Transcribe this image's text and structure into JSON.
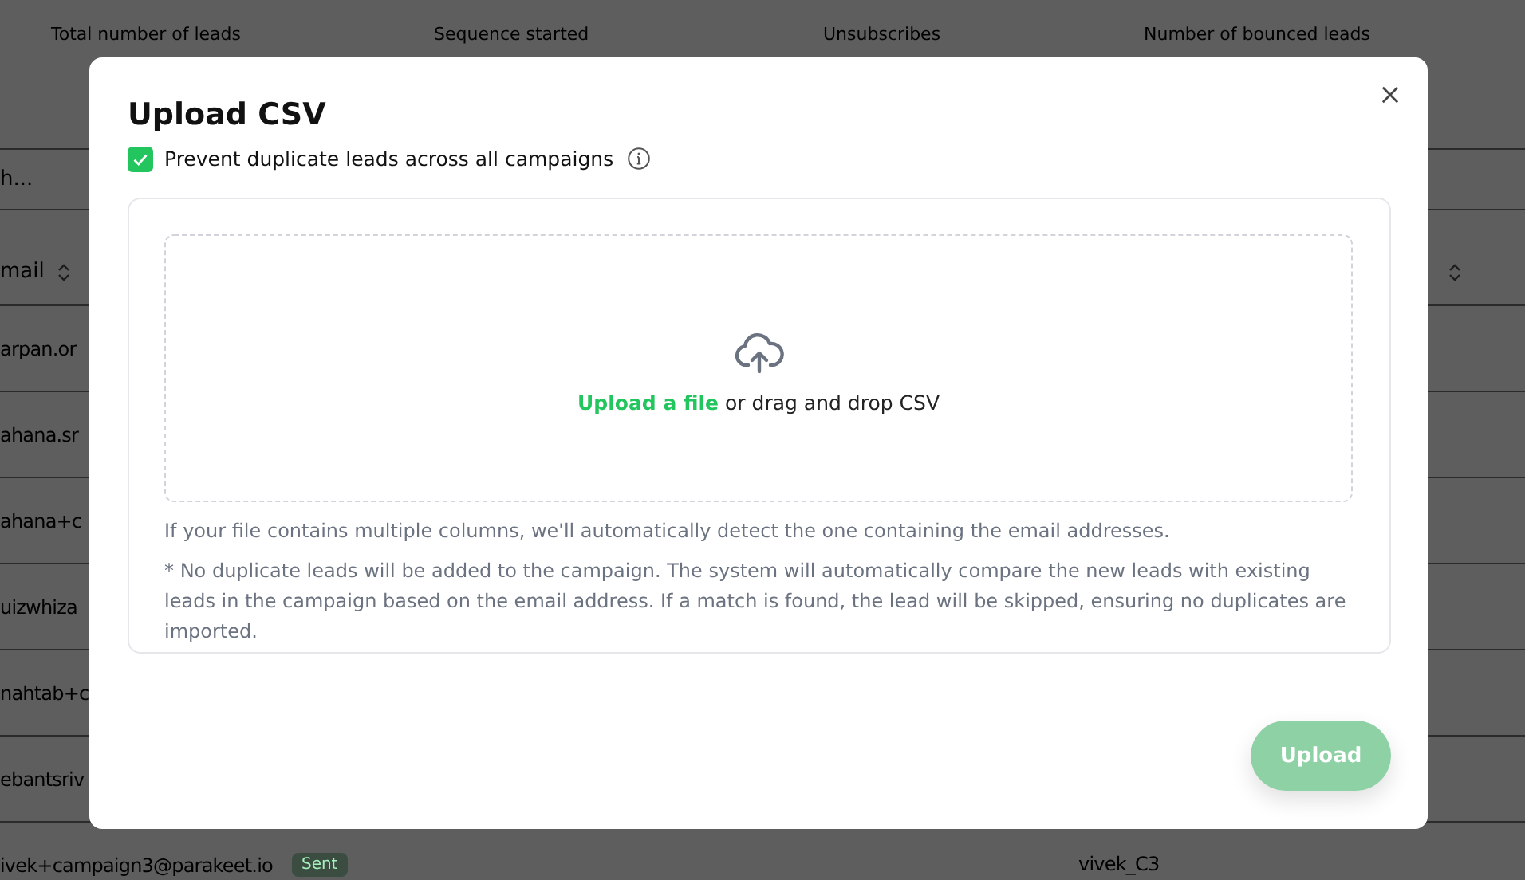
{
  "background": {
    "stats": [
      "Total number of leads",
      "Sequence started",
      "Unsubscribes",
      "Number of bounced leads"
    ],
    "search": {
      "placeholder": "h..."
    },
    "table": {
      "columns": [
        "mail"
      ],
      "rows": [
        {
          "email": "arpan.or"
        },
        {
          "email": "ahana.sr"
        },
        {
          "email": "ahana+c"
        },
        {
          "email": "uizwhiza"
        },
        {
          "email": "nahtab+c"
        },
        {
          "email": "ebantsriv"
        },
        {
          "email": "ivek+campaign3@parakeet.io",
          "status": "Sent",
          "column_3": "vivek_C3"
        }
      ]
    }
  },
  "modal": {
    "title": "Upload CSV",
    "checkbox": {
      "label": "Prevent duplicate leads across all campaigns",
      "checked": true
    },
    "dropzone": {
      "link": "Upload a file",
      "text": "or drag and drop CSV"
    },
    "notes": [
      "If your file contains multiple columns, we'll automatically detect the one containing the email addresses.",
      "* No duplicate leads will be added to the campaign. The system will automatically compare the new leads with existing leads in the campaign based on the email address. If a match is found, the lead will be skipped, ensuring no duplicates are imported."
    ],
    "button": {
      "label": "Upload",
      "disabled": true
    }
  }
}
